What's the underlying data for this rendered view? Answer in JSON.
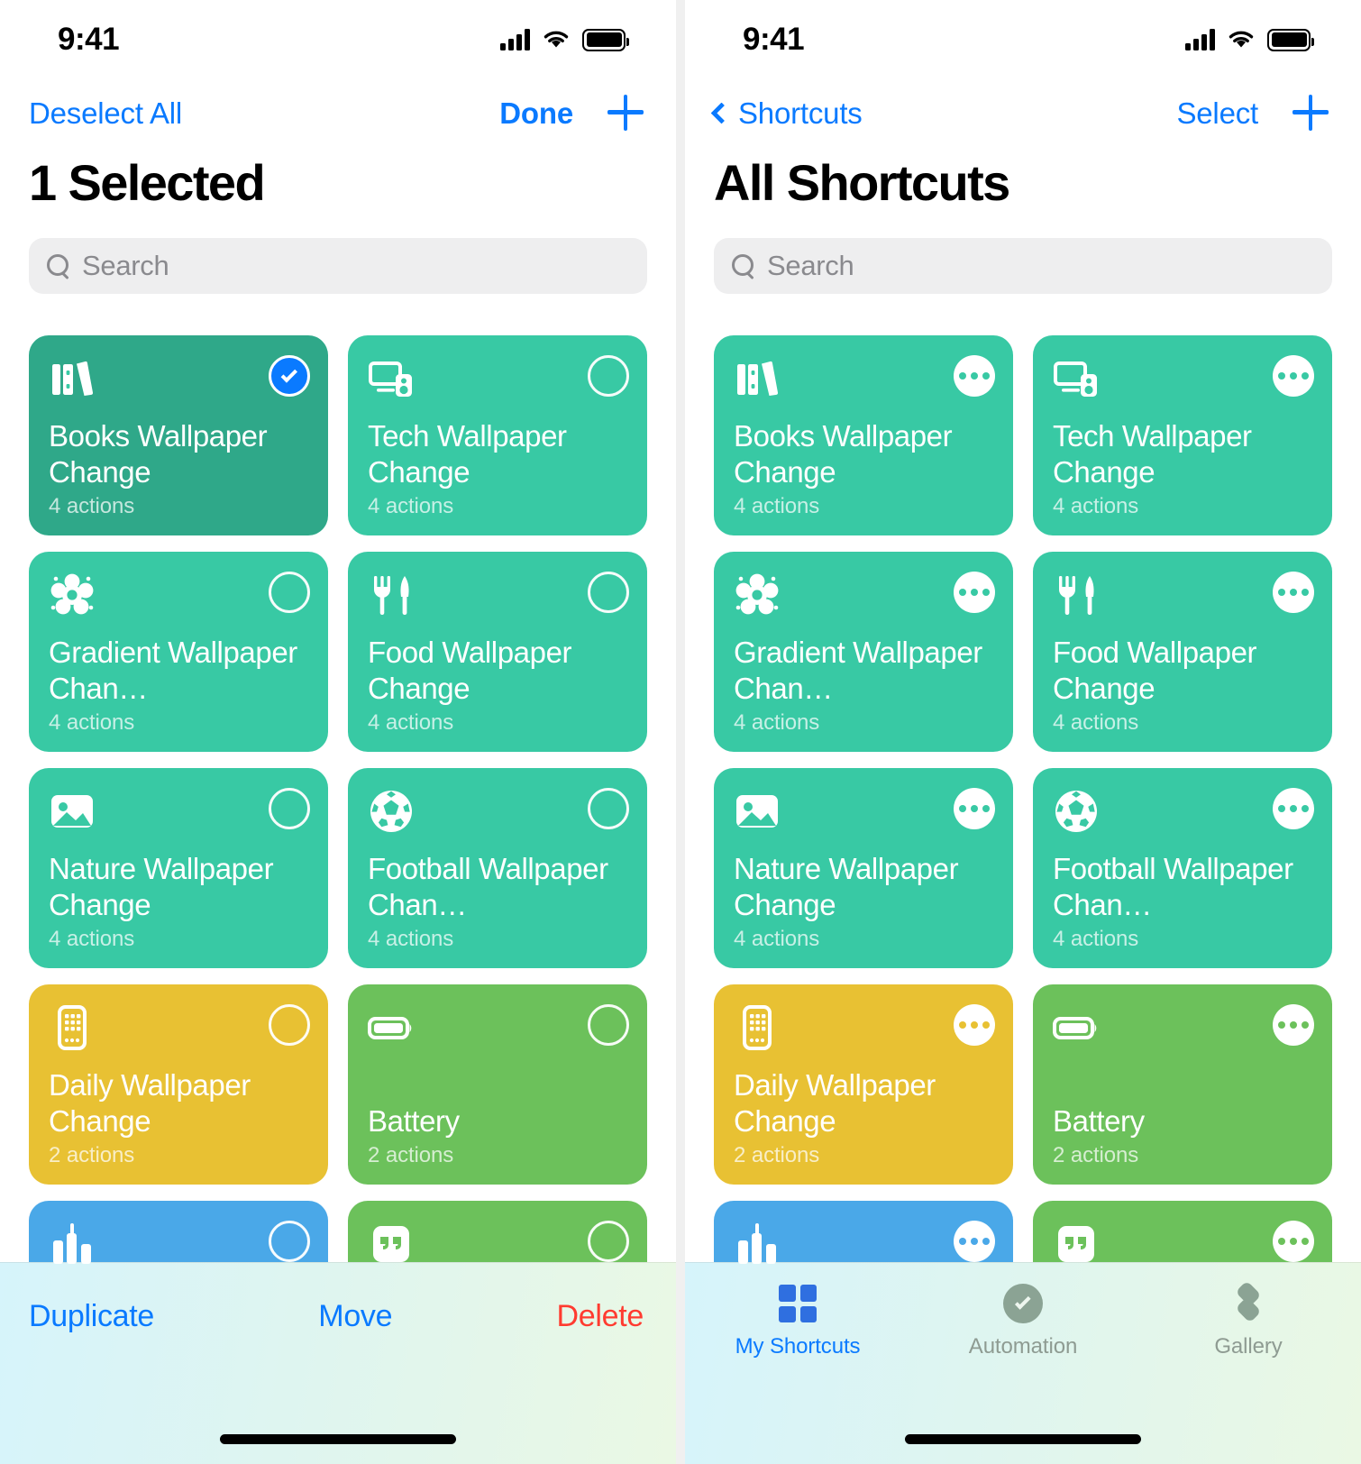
{
  "theme": {
    "accent_blue": "#0a7aff",
    "danger_red": "#ff3b30",
    "teal": "#38c9a4",
    "teal_dark": "#3aa98d",
    "yellow": "#e8c133",
    "green": "#6cc15b",
    "blue": "#4aa8e8",
    "search_bg": "#eeeeef",
    "tabbar_gradient_start": "#d6f4fb",
    "tabbar_gradient_end": "#eaf8e4"
  },
  "left_panel": {
    "status_bar": {
      "time": "9:41",
      "cellular_icon": "signal-bars-icon",
      "wifi_icon": "wifi-icon",
      "battery_icon": "battery-full-icon"
    },
    "nav": {
      "left_button": "Deselect All",
      "right_button": "Done",
      "add_button_icon": "plus-icon"
    },
    "title": "1 Selected",
    "search": {
      "placeholder": "Search",
      "value": "",
      "icon": "search-icon"
    },
    "cards": [
      {
        "title": "Books Wallpaper Change",
        "subtitle": "4 actions",
        "color": "#38c9a4",
        "icon": "books-icon",
        "selected": true
      },
      {
        "title": "Tech Wallpaper Change",
        "subtitle": "4 actions",
        "color": "#38c9a4",
        "icon": "desktop-computer-icon",
        "selected": false
      },
      {
        "title": "Gradient Wallpaper Chan…",
        "subtitle": "4 actions",
        "color": "#38c9a4",
        "icon": "flower-icon",
        "selected": false
      },
      {
        "title": "Food Wallpaper Change",
        "subtitle": "4 actions",
        "color": "#38c9a4",
        "icon": "fork-knife-icon",
        "selected": false
      },
      {
        "title": "Nature Wallpaper Change",
        "subtitle": "4 actions",
        "color": "#38c9a4",
        "icon": "photo-icon",
        "selected": false
      },
      {
        "title": "Football Wallpaper Chan…",
        "subtitle": "4 actions",
        "color": "#38c9a4",
        "icon": "soccer-ball-icon",
        "selected": false
      },
      {
        "title": "Daily Wallpaper Change",
        "subtitle": "2 actions",
        "color": "#e8c133",
        "icon": "phone-apps-icon",
        "selected": false
      },
      {
        "title": "Battery",
        "subtitle": "2 actions",
        "color": "#6cc15b",
        "icon": "battery-icon",
        "selected": false
      },
      {
        "title": "",
        "subtitle": "",
        "color": "#4aa8e8",
        "icon": "chart-icon",
        "selected": false
      },
      {
        "title": "",
        "subtitle": "",
        "color": "#6cc15b",
        "icon": "quote-icon",
        "selected": false
      }
    ],
    "toolbar": {
      "duplicate": "Duplicate",
      "move": "Move",
      "delete": "Delete"
    }
  },
  "right_panel": {
    "status_bar": {
      "time": "9:41",
      "cellular_icon": "signal-bars-icon",
      "wifi_icon": "wifi-icon",
      "battery_icon": "battery-full-icon"
    },
    "nav": {
      "back_button": "Shortcuts",
      "back_icon": "chevron-left-icon",
      "right_button": "Select",
      "add_button_icon": "plus-icon"
    },
    "title": "All Shortcuts",
    "search": {
      "placeholder": "Search",
      "value": "",
      "icon": "search-icon"
    },
    "cards": [
      {
        "title": "Books Wallpaper Change",
        "subtitle": "4 actions",
        "color": "#38c9a4",
        "icon": "books-icon"
      },
      {
        "title": "Tech Wallpaper Change",
        "subtitle": "4 actions",
        "color": "#38c9a4",
        "icon": "desktop-computer-icon"
      },
      {
        "title": "Gradient Wallpaper Chan…",
        "subtitle": "4 actions",
        "color": "#38c9a4",
        "icon": "flower-icon"
      },
      {
        "title": "Food Wallpaper Change",
        "subtitle": "4 actions",
        "color": "#38c9a4",
        "icon": "fork-knife-icon"
      },
      {
        "title": "Nature Wallpaper Change",
        "subtitle": "4 actions",
        "color": "#38c9a4",
        "icon": "photo-icon"
      },
      {
        "title": "Football Wallpaper Chan…",
        "subtitle": "4 actions",
        "color": "#38c9a4",
        "icon": "soccer-ball-icon"
      },
      {
        "title": "Daily Wallpaper Change",
        "subtitle": "2 actions",
        "color": "#e8c133",
        "icon": "phone-apps-icon"
      },
      {
        "title": "Battery",
        "subtitle": "2 actions",
        "color": "#6cc15b",
        "icon": "battery-icon"
      },
      {
        "title": "",
        "subtitle": "",
        "color": "#4aa8e8",
        "icon": "chart-icon"
      },
      {
        "title": "",
        "subtitle": "",
        "color": "#6cc15b",
        "icon": "quote-icon"
      }
    ],
    "tabs": [
      {
        "label": "My Shortcuts",
        "icon": "grid-squares-icon",
        "active": true
      },
      {
        "label": "Automation",
        "icon": "automation-check-icon",
        "active": false
      },
      {
        "label": "Gallery",
        "icon": "gallery-layers-icon",
        "active": false
      }
    ]
  }
}
